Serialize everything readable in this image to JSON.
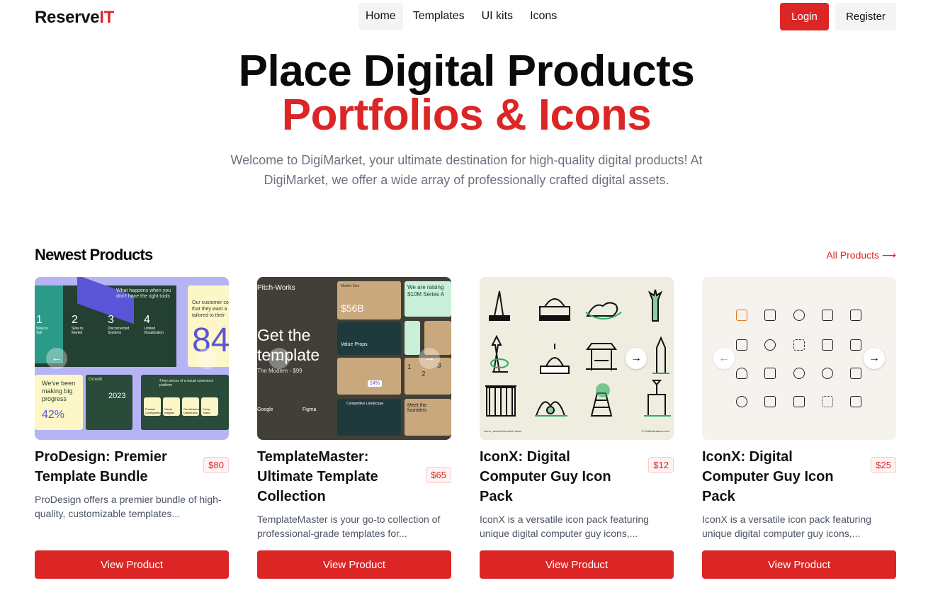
{
  "brand": {
    "name_main": "Reserve",
    "name_accent": "IT"
  },
  "nav": {
    "links": [
      "Home",
      "Templates",
      "UI kits",
      "Icons"
    ],
    "login": "Login",
    "register": "Register"
  },
  "hero": {
    "title_line1": "Place Digital Products",
    "title_line2": "Portfolios & Icons",
    "description": "Welcome to DigiMarket, your ultimate destination for high-quality digital products! At DigiMarket, we offer a wide array of professionally crafted digital assets."
  },
  "section": {
    "title": "Newest Products",
    "all_link": "All Products ⟶"
  },
  "products": [
    {
      "title": "ProDesign: Premier Template Bundle",
      "price": "$80",
      "description": "ProDesign offers a premier bundle of high-quality, customizable templates...",
      "button": "View Product",
      "thumb": {
        "heading": "What happens when you don't have the right tools",
        "steps": [
          {
            "n": "1",
            "label": "Slow to Sell"
          },
          {
            "n": "2",
            "label": "Slow to Market"
          },
          {
            "n": "3",
            "label": "Disconnected Systems"
          },
          {
            "n": "4",
            "label": "Limited Visualization"
          }
        ],
        "customer": "Our customer co that they want a tailored to their",
        "big_number": "84",
        "progress": "We've been making big progress",
        "percent": "42%",
        "growth": "Growth",
        "year": "2023",
        "pieces": "4 key pieces of a visual commerce platform",
        "piece_labels": [
          "Product Configuration",
          "Visual Insights",
          "Omnichannel Distribution",
          "Comp Stand"
        ]
      }
    },
    {
      "title": "TemplateMaster: Ultimate Template Collection",
      "price": "$65",
      "description": "TemplateMaster is your go-to collection of professional-grade templates for...",
      "button": "View Product",
      "thumb": {
        "brand": "Pitch-Works",
        "headline": "Get the template",
        "sub": "The Modern - $99",
        "market": "Market Size",
        "market_value": "$56B",
        "raising": "We are raising $10M Series A",
        "props": "Value Props",
        "percent": "24%",
        "nums": [
          "1",
          "2",
          "3"
        ],
        "landscape": "Competitive Landscape",
        "founders": "Meet the founders",
        "logos": [
          "Google",
          "Figma"
        ]
      }
    },
    {
      "title": "IconX: Digital Computer Guy Icon Pack",
      "price": "$12",
      "description": "IconX is a versatile icon pack featuring unique digital computer guy icons,...",
      "button": "View Product",
      "thumb": {
        "caption_left": "Icons | around the world icons",
        "caption_right": "© GetIllustrations.com"
      }
    },
    {
      "title": "IconX: Digital Computer Guy Icon Pack",
      "price": "$25",
      "description": "IconX is a versatile icon pack featuring unique digital computer guy icons,...",
      "button": "View Product",
      "thumb": {}
    }
  ],
  "colors": {
    "accent": "#dc2626",
    "muted": "#6b7280"
  }
}
